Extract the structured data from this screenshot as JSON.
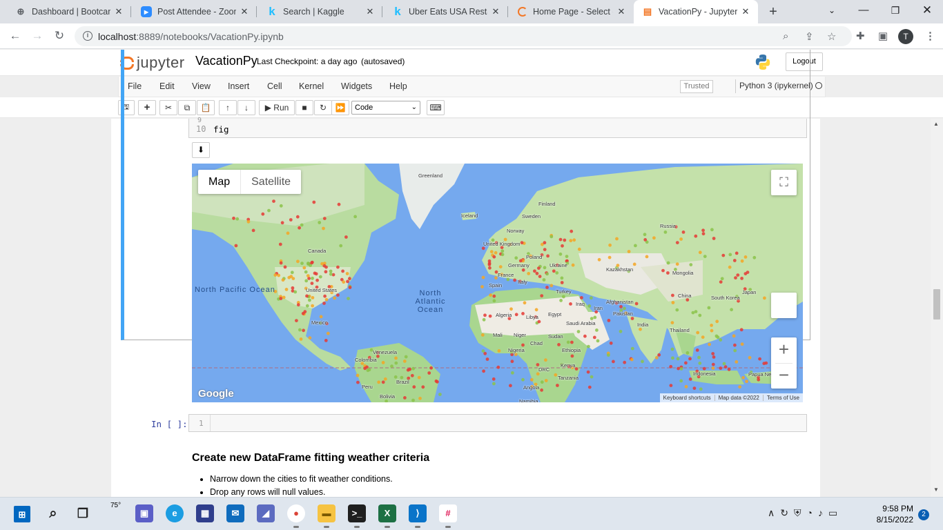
{
  "browser": {
    "tabs": [
      {
        "title": "Dashboard | Bootcamp",
        "icon": "globe-icon"
      },
      {
        "title": "Post Attendee - Zoom",
        "icon": "zoom-icon"
      },
      {
        "title": "Search | Kaggle",
        "icon": "kaggle-icon"
      },
      {
        "title": "Uber Eats USA Restaurants",
        "icon": "kaggle-icon"
      },
      {
        "title": "Home Page - Select or",
        "icon": "loading-icon"
      },
      {
        "title": "VacationPy - Jupyter Notebook",
        "icon": "jupyter-icon"
      }
    ],
    "active_tab": 5,
    "url_host": "localhost",
    "url_rest": ":8889/notebooks/VacationPy.ipynb",
    "profile_initial": "T"
  },
  "jupyter": {
    "logo_text": "jupyter",
    "notebook_name": "VacationPy",
    "checkpoint": "Last Checkpoint: a day ago",
    "autosaved": "(autosaved)",
    "logout": "Logout",
    "menus": [
      "File",
      "Edit",
      "View",
      "Insert",
      "Cell",
      "Kernel",
      "Widgets",
      "Help"
    ],
    "trusted": "Trusted",
    "kernel_name": "Python 3 (ipykernel)",
    "toolbar": {
      "run_label": "Run",
      "cell_type": "Code"
    }
  },
  "cells": {
    "code_line_partial": "9",
    "code_line_no": "10",
    "code_text": "fig",
    "empty_prompt": "In [ ]:",
    "empty_line_no": "1"
  },
  "map": {
    "type_buttons": [
      "Map",
      "Satellite"
    ],
    "google": "Google",
    "footer": [
      "Keyboard shortcuts",
      "Map data ©2022",
      "Terms of Use"
    ],
    "oceans": [
      "North Pacific Ocean",
      "North Atlantic Ocean"
    ],
    "labels": [
      "Greenland",
      "Finland",
      "Sweden",
      "Iceland",
      "Norway",
      "Russia",
      "United Kingdom",
      "Poland",
      "Germany",
      "Ukraine",
      "Kazakhstan",
      "France",
      "Italy",
      "Spain",
      "Mongolia",
      "Canada",
      "United States",
      "Turkey",
      "Iraq",
      "Iran",
      "Afghanistan",
      "China",
      "South Korea",
      "Japan",
      "Pakistan",
      "Algeria",
      "Libya",
      "Egypt",
      "Saudi Arabia",
      "India",
      "Mexico",
      "Thailand",
      "Mali",
      "Niger",
      "Chad",
      "Sudan",
      "Nigeria",
      "Ethiopia",
      "Venezuela",
      "Colombia",
      "Kenya",
      "DRC",
      "Tanzania",
      "Indonesia",
      "Papua New Guinea",
      "Brazil",
      "Peru",
      "Bolivia",
      "Angola",
      "Namibia"
    ]
  },
  "markdown": {
    "heading": "Create new DataFrame fitting weather criteria",
    "bullets": [
      "Narrow down the cities to fit weather conditions.",
      "Drop any rows will null values."
    ]
  },
  "taskbar": {
    "weather_temp": "75°",
    "time": "9:58 PM",
    "date": "8/15/2022",
    "notifications": "2"
  }
}
